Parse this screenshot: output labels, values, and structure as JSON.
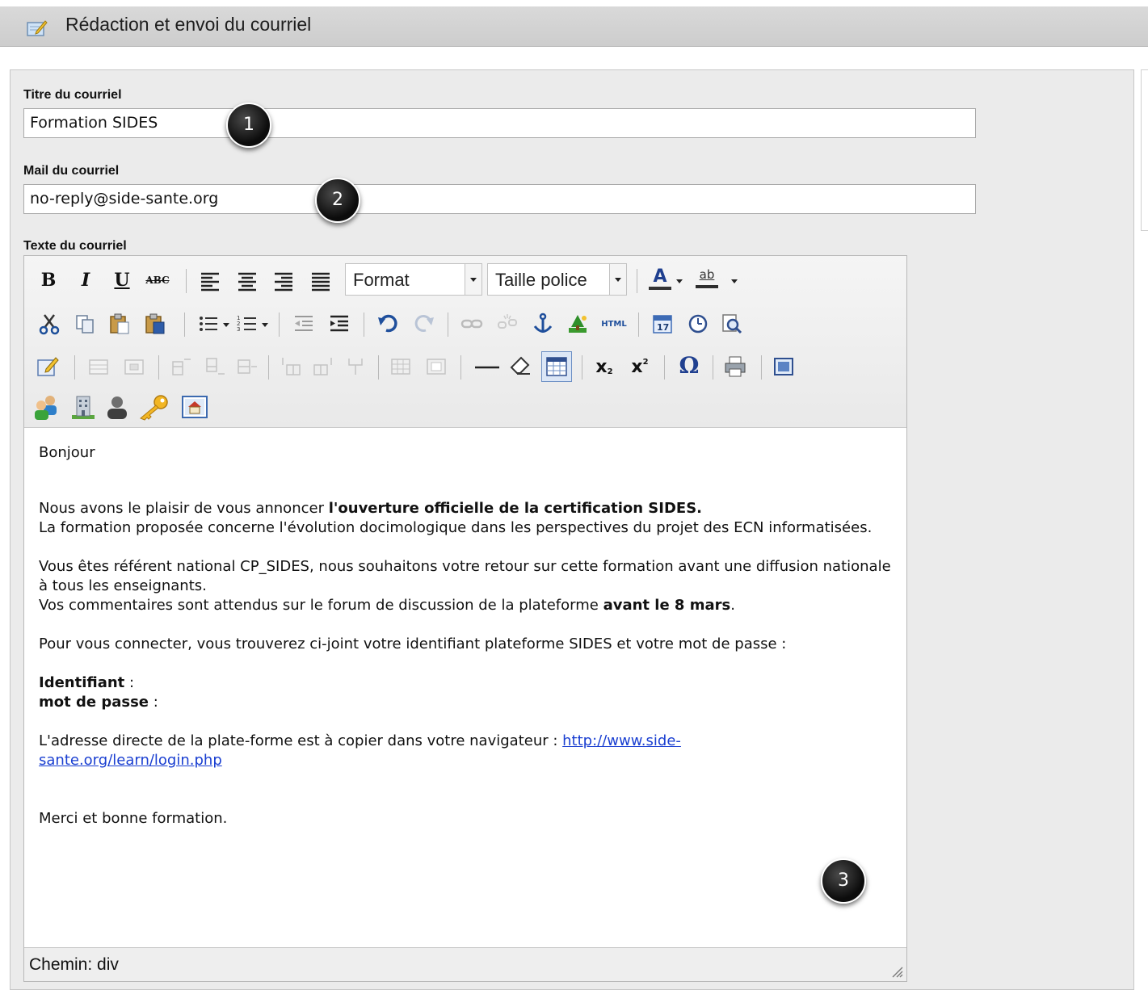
{
  "header": {
    "title": "Rédaction et envoi du courriel",
    "icon": "edit-note-icon"
  },
  "form": {
    "title_label": "Titre du courriel",
    "title_value": "Formation SIDES",
    "mail_label": "Mail du courriel",
    "mail_value": "no-reply@side-sante.org",
    "text_label": "Texte du courriel"
  },
  "markers": [
    "1",
    "2",
    "3"
  ],
  "toolbar": {
    "bold": "B",
    "italic": "I",
    "underline": "U",
    "strike": "ABC",
    "format_select": "Format",
    "size_select": "Taille police",
    "font_color": "A",
    "highlight": "ab",
    "html_button": "HTML",
    "subscript": "x",
    "superscript": "x",
    "special_char": "Ω"
  },
  "body": {
    "greeting": "Bonjour",
    "p1_start": "Nous avons le plaisir de vous annoncer ",
    "p1_bold": "l'ouverture officielle de la certification SIDES.",
    "p1_line2": "La formation proposée concerne l'évolution docimologique dans les perspectives du projet des ECN informatisées.",
    "p2_line1": "Vous êtes référent national CP_SIDES, nous souhaitons votre retour sur cette formation avant une diffusion nationale à tous les enseignants.",
    "p2_line2_start": "Vos commentaires sont attendus sur le forum de discussion de la plateforme ",
    "p2_line2_bold": "avant le 8 mars",
    "p2_line2_end": ".",
    "p3": "Pour vous connecter, vous trouverez ci-joint votre identifiant plateforme SIDES et votre mot de passe :",
    "id_label": "Identifiant",
    "id_sep": " :",
    "pwd_label": "mot de passe",
    "pwd_sep": " :",
    "p4_start": "L'adresse directe de la plate-forme est à copier dans votre navigateur : ",
    "p4_link": "http://www.side-sante.org/learn/login.php",
    "closing": "Merci et bonne formation."
  },
  "status": {
    "path": "Chemin: div"
  }
}
